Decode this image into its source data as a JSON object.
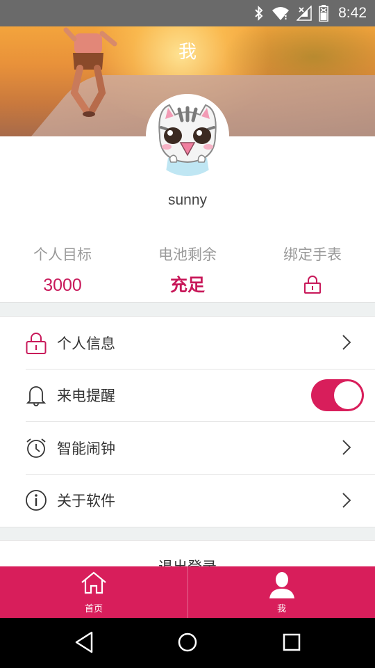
{
  "status_bar": {
    "time": "8:42",
    "icons": [
      "bluetooth-icon",
      "wifi-icon",
      "signal-icon",
      "battery-icon"
    ]
  },
  "header": {
    "title": "我"
  },
  "profile": {
    "username": "sunny"
  },
  "stats": [
    {
      "label": "个人目标",
      "value": "3000"
    },
    {
      "label": "电池剩余",
      "value": "充足"
    },
    {
      "label": "绑定手表",
      "icon": "lock-icon"
    }
  ],
  "menu": [
    {
      "label": "个人信息",
      "icon": "lock-icon",
      "control": "chevron"
    },
    {
      "label": "来电提醒",
      "icon": "bell-icon",
      "control": "toggle",
      "toggle_on": true
    },
    {
      "label": "智能闹钟",
      "icon": "alarm-clock-icon",
      "control": "chevron"
    },
    {
      "label": "关于软件",
      "icon": "info-icon",
      "control": "chevron"
    }
  ],
  "logout_label": "退出登录",
  "tabbar": {
    "tabs": [
      {
        "label": "首页",
        "icon": "home-icon"
      },
      {
        "label": "我",
        "icon": "person-icon",
        "active": true
      }
    ]
  },
  "navbar": {
    "buttons": [
      "back-icon",
      "home-circle-icon",
      "recents-icon"
    ]
  },
  "colors": {
    "accent": "#d81e5b",
    "status_bar": "#6a6a6a",
    "stat_label": "#9a9a9a"
  }
}
